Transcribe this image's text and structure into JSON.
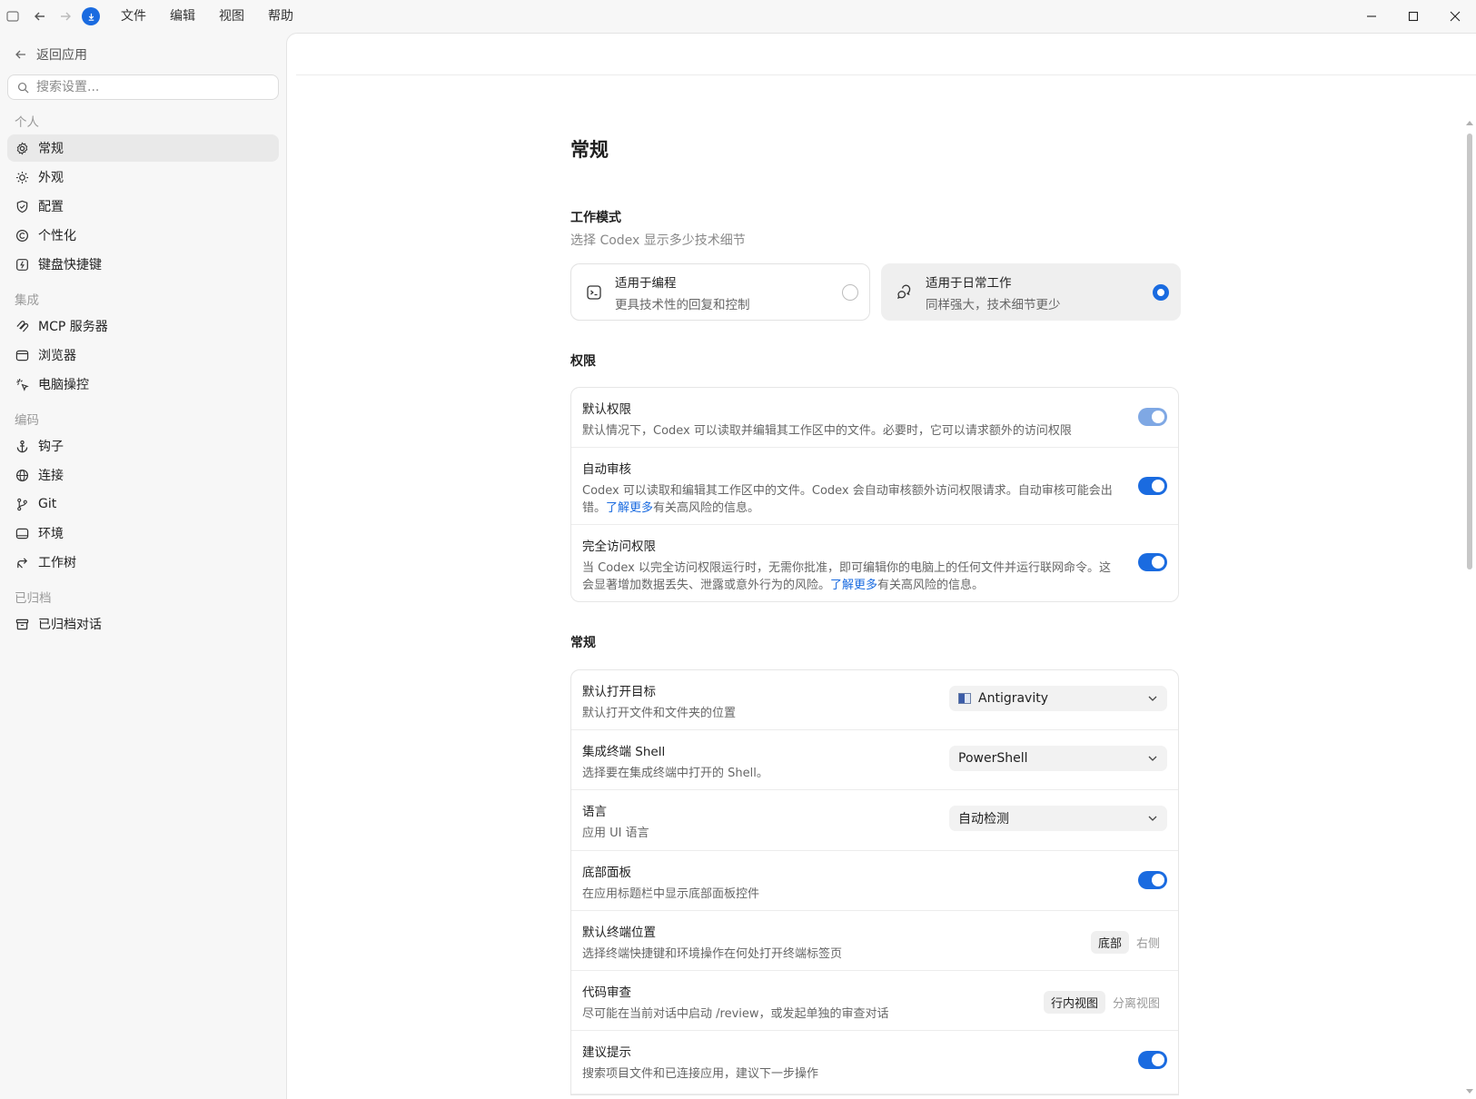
{
  "titlebar": {
    "menu": [
      "文件",
      "编辑",
      "视图",
      "帮助"
    ]
  },
  "sidebar": {
    "back_label": "返回应用",
    "search_placeholder": "搜索设置...",
    "groups": [
      {
        "label": "个人",
        "items": [
          {
            "label": "常规",
            "icon": "gear-icon",
            "active": true
          },
          {
            "label": "外观",
            "icon": "sun-icon"
          },
          {
            "label": "配置",
            "icon": "shield-icon"
          },
          {
            "label": "个性化",
            "icon": "personalize-icon"
          },
          {
            "label": "键盘快捷键",
            "icon": "keyboard-icon"
          }
        ]
      },
      {
        "label": "集成",
        "items": [
          {
            "label": "MCP 服务器",
            "icon": "mcp-icon"
          },
          {
            "label": "浏览器",
            "icon": "browser-icon"
          },
          {
            "label": "电脑操控",
            "icon": "sparkle-cursor-icon"
          }
        ]
      },
      {
        "label": "编码",
        "items": [
          {
            "label": "钩子",
            "icon": "anchor-icon"
          },
          {
            "label": "连接",
            "icon": "globe-icon"
          },
          {
            "label": "Git",
            "icon": "git-branch-icon"
          },
          {
            "label": "环境",
            "icon": "terminal-window-icon"
          },
          {
            "label": "工作树",
            "icon": "worktree-icon"
          }
        ]
      },
      {
        "label": "已归档",
        "items": [
          {
            "label": "已归档对话",
            "icon": "archive-icon"
          }
        ]
      }
    ]
  },
  "page": {
    "title": "常规",
    "work_mode": {
      "title": "工作模式",
      "subtitle": "选择 Codex 显示多少技术细节",
      "options": [
        {
          "title": "适用于编程",
          "desc": "更具技术性的回复和控制",
          "selected": false
        },
        {
          "title": "适用于日常工作",
          "desc": "同样强大，技术细节更少",
          "selected": true
        }
      ]
    },
    "permissions": {
      "title": "权限",
      "rows": [
        {
          "title": "默认权限",
          "desc": "默认情况下，Codex 可以读取并编辑其工作区中的文件。必要时，它可以请求额外的访问权限",
          "toggle": true
        },
        {
          "title": "自动审核",
          "desc_before": "Codex 可以读取和编辑其工作区中的文件。Codex 会自动审核额外访问权限请求。自动审核可能会出错。",
          "link": "了解更多",
          "desc_after": "有关高风险的信息。",
          "toggle": true
        },
        {
          "title": "完全访问权限",
          "desc_before": "当 Codex 以完全访问权限运行时，无需你批准，即可编辑你的电脑上的任何文件并运行联网命令。这会显著增加数据丢失、泄露或意外行为的风险。",
          "link": "了解更多",
          "desc_after": "有关高风险的信息。",
          "toggle": true
        }
      ]
    },
    "general": {
      "title": "常规",
      "rows": [
        {
          "title": "默认打开目标",
          "desc": "默认打开文件和文件夹的位置",
          "select": "Antigravity"
        },
        {
          "title": "集成终端 Shell",
          "desc": "选择要在集成终端中打开的 Shell。",
          "select": "PowerShell"
        },
        {
          "title": "语言",
          "desc": "应用 UI 语言",
          "select": "自动检测"
        },
        {
          "title": "底部面板",
          "desc": "在应用标题栏中显示底部面板控件",
          "toggle": true
        },
        {
          "title": "默认终端位置",
          "desc": "选择终端快捷键和环境操作在何处打开终端标签页",
          "segments": [
            "底部",
            "右侧"
          ],
          "selected": "底部"
        },
        {
          "title": "代码审查",
          "desc": "尽可能在当前对话中启动 /review，或发起单独的审查对话",
          "segments": [
            "行内视图",
            "分离视图"
          ],
          "selected": "行内视图"
        },
        {
          "title": "建议提示",
          "desc": "搜索项目文件和已连接应用，建议下一步操作",
          "toggle": true
        }
      ]
    }
  }
}
